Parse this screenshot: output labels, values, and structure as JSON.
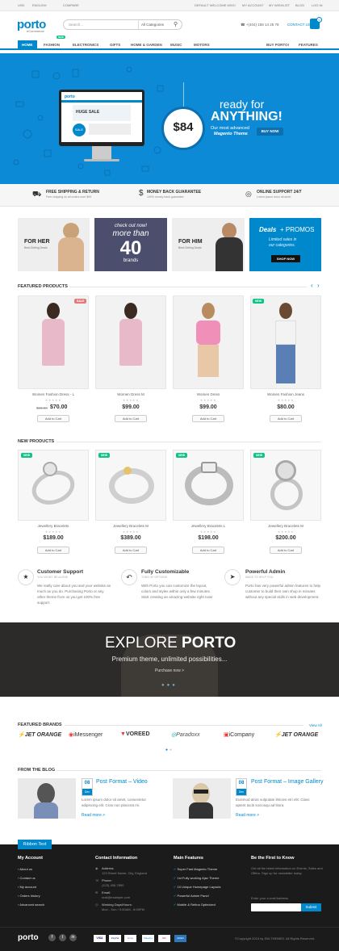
{
  "topbar": {
    "currency": "USD",
    "language": "ENGLISH",
    "compare": "COMPARE",
    "welcome": "DEFAULT WELCOME MSG!",
    "my_account": "MY ACCOUNT",
    "wishlist": "MY WISHLIST",
    "blog": "BLOG",
    "login": "LOG IN"
  },
  "header": {
    "logo": "porto",
    "logo_sub": "eCommerce",
    "search_placeholder": "Search...",
    "category": "All Categories",
    "phone": "+(404) 158 14 25 78",
    "contact": "CONTACT US",
    "cart_count": "0"
  },
  "nav": {
    "items": [
      "HOME",
      "FASHION",
      "ELECTRONICS",
      "GIFTS",
      "HOME & GARDEN",
      "MUSIC",
      "MOTORS"
    ],
    "new_badge": "NEW",
    "right": [
      "BUY PORTO!",
      "FEATURES"
    ]
  },
  "hero": {
    "ready": "ready for",
    "anything": "ANYTHING!",
    "price": "$84",
    "desc1": "Our most advanced",
    "desc2": "Magento Theme",
    "cta": "BUY NOW",
    "screen_logo": "porto",
    "screen_banner": "HUGE SALE",
    "screen_badge": "SALE"
  },
  "features": [
    {
      "title": "FREE SHIPPING & RETURN",
      "sub": "Free shipping on all orders over $99.",
      "icon": "truck-icon"
    },
    {
      "title": "MONEY BACK GUARANTEE",
      "sub": "100% money back guarantee",
      "icon": "dollar-icon"
    },
    {
      "title": "ONLINE SUPPORT 24/7",
      "sub": "Lorem ipsum dolor sit amet.",
      "icon": "lifebuoy-icon"
    }
  ],
  "banners": {
    "her": "FOR HER",
    "her_sub": "Best-Selling Deals",
    "check": "check out now!",
    "more": "more than",
    "forty": "40",
    "brands": "brands",
    "him": "FOR HIM",
    "him_sub": "Best-Selling Deals",
    "deals": "Deals",
    "promos": "+ PROMOS",
    "deals_sub1": "Limited sales in",
    "deals_sub2": "our categories.",
    "shop_now": "SHOP NOW"
  },
  "featured": {
    "title": "FEATURED PRODUCTS",
    "items": [
      {
        "name": "Women Fashion Dress - L",
        "old": "$90.00",
        "price": "$70.00",
        "tag": "SALE",
        "btn": "Add to Cart"
      },
      {
        "name": "Women Dress M",
        "old": "",
        "price": "$99.00",
        "tag": "",
        "btn": "Add to Cart"
      },
      {
        "name": "Women Dress",
        "old": "",
        "price": "$99.00",
        "tag": "",
        "btn": "Add to Cart"
      },
      {
        "name": "Women Fashion Jeans",
        "old": "",
        "price": "$80.00",
        "tag": "NEW",
        "btn": "Add to Cart"
      }
    ]
  },
  "newp": {
    "title": "NEW PRODUCTS",
    "items": [
      {
        "name": "Jewellery Bracelets",
        "price": "$189.00",
        "tag": "NEW",
        "btn": "Add to Cart"
      },
      {
        "name": "Jewellery Bracelets M",
        "price": "$389.00",
        "tag": "NEW",
        "btn": "Add to Cart"
      },
      {
        "name": "Jewellery Bracelets L",
        "price": "$198.00",
        "tag": "NEW",
        "btn": "Add to Cart"
      },
      {
        "name": "Jewellery Bracelets M",
        "price": "$200.00",
        "tag": "NEW",
        "btn": "Add to Cart"
      }
    ]
  },
  "services": [
    {
      "title": "Customer Support",
      "sub": "YOU WON'T BE ALONE",
      "text": "We really care about you and your website as much as you do. Purchasing Porto or any other theme from us you get 100% free support."
    },
    {
      "title": "Fully Customizable",
      "sub": "TONS OF OPTIONS",
      "text": "With Porto you can customize the layout, colors and styles within only a few minutes. Start creating an amazing website right now!"
    },
    {
      "title": "Powerful Admin",
      "sub": "MADE TO HELP YOU",
      "text": "Porto has very powerful admin features to help customer to build their own shop in minutes without any special skills in web development."
    }
  ],
  "explore": {
    "title1": "EXPLORE",
    "title2": "PORTO",
    "sub": "Premium theme, unlimited possibilities...",
    "cta": "Purchase now >"
  },
  "brands": {
    "title": "FEATURED BRANDS",
    "view_all": "View All",
    "items": [
      "JET ORANGE",
      "iMessenger",
      "VOREED",
      "Paradoxx",
      "iCompany",
      "JET ORANGE"
    ]
  },
  "blog": {
    "title": "FROM THE BLOG",
    "posts": [
      {
        "day": "08",
        "month": "Dec",
        "title": "Post Format – Video",
        "text": "Lorem ipsum dolor sit amet, consectetur adipiscing elit. Cras non placerat mi.",
        "more": "Read more >"
      },
      {
        "day": "08",
        "month": "Dec",
        "title": "Post Format – Image Gallery",
        "text": "Euismod atras vulputate iltricies etri elit. Class aptent taciti sociosqu ad litora.",
        "more": "Read more >"
      }
    ]
  },
  "footer": {
    "ribbon": "Ribbon Text",
    "cols": [
      {
        "title": "My Account",
        "items": [
          "About us",
          "Contact us",
          "My account",
          "Orders history",
          "Advanced search"
        ]
      },
      {
        "title": "Contact Information",
        "items": [
          "Address",
          "123 Street Name, City, England",
          "Phone:",
          "(123) 456-7890",
          "Email:",
          "mail@example.com",
          "Working Days/Hours:",
          "Mon - Sun / 9:00AM - 8:00PM"
        ]
      },
      {
        "title": "Main Features",
        "items": [
          "Super Fast Magento Theme",
          "1st Fully working Ajax Theme",
          "10 Unique Homepage Layouts",
          "Powerful Admin Panel",
          "Mobile & Retina Optimized"
        ]
      },
      {
        "title": "Be the First to Know",
        "items": [
          "Get all the latest information on Events, Sales and Offers. Sign up for newsletter today."
        ]
      }
    ],
    "email_placeholder": "Enter your e-mail Address",
    "submit": "Submit",
    "copyright": "©Copyright 2015 by SW-THEMES. All Rights Reserved.",
    "logo": "porto",
    "payments": [
      "VISA",
      "PayPal",
      "stripe",
      "Maestro",
      "MC",
      "AMEX"
    ]
  }
}
